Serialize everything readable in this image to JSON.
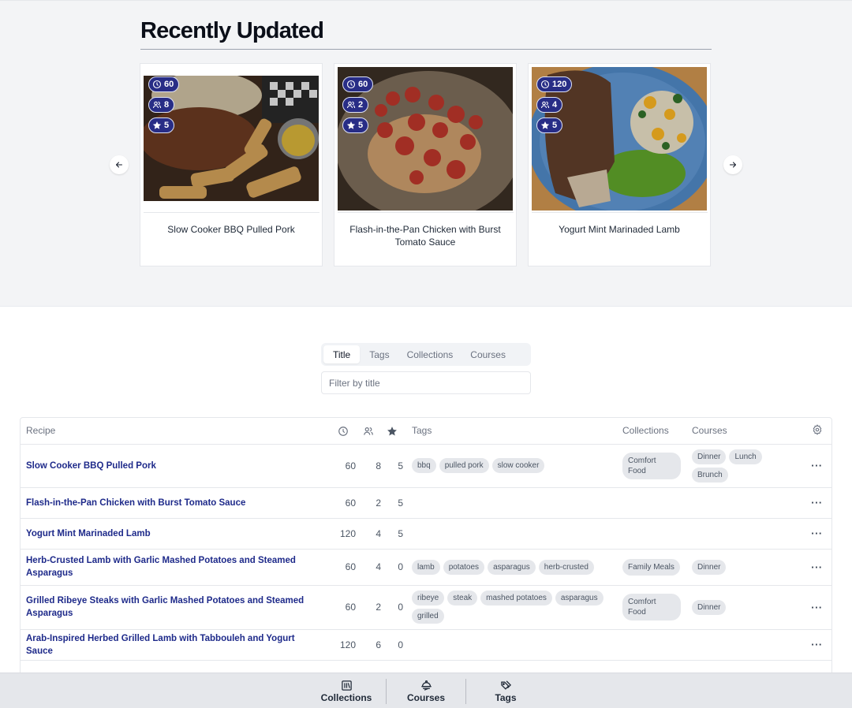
{
  "hero": {
    "title": "Recently Updated",
    "cards": [
      {
        "title": "Slow Cooker BBQ Pulled Pork",
        "time": "60",
        "servings": "8",
        "rating": "5",
        "image": "pulled-pork-sandwich-with-fries"
      },
      {
        "title": "Flash-in-the-Pan Chicken with Burst Tomato Sauce",
        "time": "60",
        "servings": "2",
        "rating": "5",
        "image": "chicken-with-cherry-tomatoes"
      },
      {
        "title": "Yogurt Mint Marinaded Lamb",
        "time": "120",
        "servings": "4",
        "rating": "5",
        "image": "lamb-shank-on-blue-plate"
      }
    ],
    "prev_icon": "arrow-left-icon",
    "next_icon": "arrow-right-icon"
  },
  "filter": {
    "tabs": [
      {
        "label": "Title",
        "active": true
      },
      {
        "label": "Tags",
        "active": false
      },
      {
        "label": "Collections",
        "active": false
      },
      {
        "label": "Courses",
        "active": false
      }
    ],
    "input_placeholder": "Filter by title",
    "input_value": ""
  },
  "table": {
    "headers": {
      "recipe": "Recipe",
      "time_icon": "clock-icon",
      "servings_icon": "users-icon",
      "rating_icon": "star-icon",
      "tags": "Tags",
      "collections": "Collections",
      "courses": "Courses",
      "settings_icon": "gear-icon"
    },
    "rows": [
      {
        "title": "Slow Cooker BBQ Pulled Pork",
        "time": "60",
        "servings": "8",
        "rating": "5",
        "tags": [
          "bbq",
          "pulled pork",
          "slow cooker"
        ],
        "collections": [
          "Comfort Food"
        ],
        "courses": [
          "Dinner",
          "Lunch",
          "Brunch"
        ]
      },
      {
        "title": "Flash-in-the-Pan Chicken with Burst Tomato Sauce",
        "time": "60",
        "servings": "2",
        "rating": "5",
        "tags": [],
        "collections": [],
        "courses": []
      },
      {
        "title": "Yogurt Mint Marinaded Lamb",
        "time": "120",
        "servings": "4",
        "rating": "5",
        "tags": [],
        "collections": [],
        "courses": []
      },
      {
        "title": "Herb-Crusted Lamb with Garlic Mashed Potatoes and Steamed Asparagus",
        "time": "60",
        "servings": "4",
        "rating": "0",
        "tags": [
          "lamb",
          "potatoes",
          "asparagus",
          "herb-crusted"
        ],
        "collections": [
          "Family Meals"
        ],
        "courses": [
          "Dinner"
        ]
      },
      {
        "title": "Grilled Ribeye Steaks with Garlic Mashed Potatoes and Steamed Asparagus",
        "time": "60",
        "servings": "2",
        "rating": "0",
        "tags": [
          "ribeye",
          "steak",
          "mashed potatoes",
          "asparagus",
          "grilled"
        ],
        "collections": [
          "Comfort Food"
        ],
        "courses": [
          "Dinner"
        ]
      },
      {
        "title": "Arab-Inspired Herbed Grilled Lamb with Tabbouleh and Yogurt Sauce",
        "time": "120",
        "servings": "6",
        "rating": "0",
        "tags": [],
        "collections": [],
        "courses": []
      }
    ],
    "row_actions_label": "···"
  },
  "bottom_nav": {
    "items": [
      {
        "label": "Collections",
        "icon": "library-icon"
      },
      {
        "label": "Courses",
        "icon": "cloche-icon"
      },
      {
        "label": "Tags",
        "icon": "tags-icon"
      }
    ]
  },
  "colors": {
    "accent": "#1e2a8a",
    "badge_bg": "#282d86",
    "hero_bg": "#f3f4f6",
    "pill_bg": "#e5e7eb",
    "nav_bg": "#e5e7eb"
  }
}
